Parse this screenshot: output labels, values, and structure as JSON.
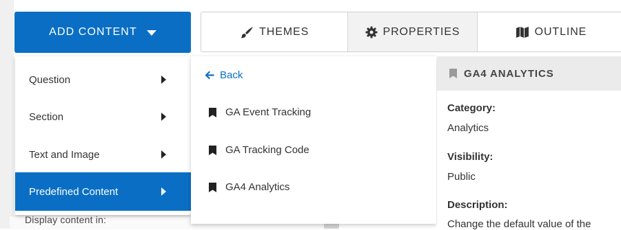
{
  "background": {
    "partial_text": "Display content in:"
  },
  "toolbar": {
    "add_content_label": "ADD CONTENT",
    "tabs": [
      {
        "label": "THEMES",
        "icon": "brush-icon"
      },
      {
        "label": "PROPERTIES",
        "icon": "gear-icon"
      },
      {
        "label": "OUTLINE",
        "icon": "map-icon"
      }
    ]
  },
  "menu": {
    "items": [
      {
        "label": "Question",
        "active": false
      },
      {
        "label": "Section",
        "active": false
      },
      {
        "label": "Text and Image",
        "active": false
      },
      {
        "label": "Predefined Content",
        "active": true
      }
    ]
  },
  "submenu": {
    "back_label": "Back",
    "items": [
      {
        "label": "GA Event Tracking",
        "icon": "bookmark-icon"
      },
      {
        "label": "GA Tracking Code",
        "icon": "bookmark-icon"
      },
      {
        "label": "GA4 Analytics",
        "icon": "bookmark-icon"
      }
    ]
  },
  "panel": {
    "title": "GA4 ANALYTICS",
    "category_label": "Category:",
    "category_value": "Analytics",
    "visibility_label": "Visibility:",
    "visibility_value": "Public",
    "description_label": "Description:",
    "description_value": "Change the default value of the"
  },
  "colors": {
    "accent": "#0a6fc4",
    "panel_header": "#ebebeb"
  }
}
